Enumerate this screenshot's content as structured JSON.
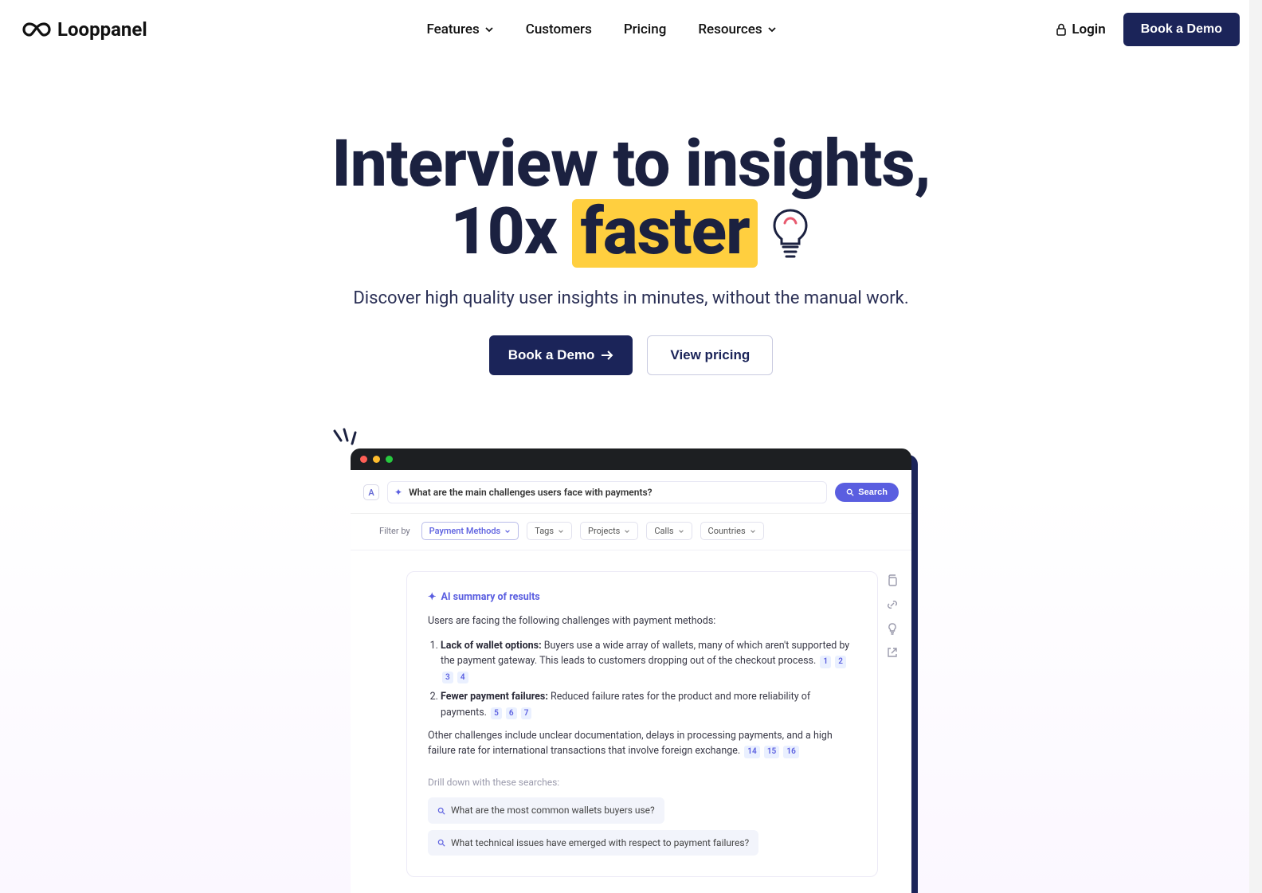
{
  "nav": {
    "brand": "Looppanel",
    "items": {
      "features": "Features",
      "customers": "Customers",
      "pricing": "Pricing",
      "resources": "Resources"
    },
    "login": "Login",
    "cta": "Book a Demo"
  },
  "hero": {
    "title_line1": "Interview to insights,",
    "title_prefix": "10x ",
    "title_highlight": "faster",
    "subtitle": "Discover high quality user insights in minutes, without the manual work.",
    "primary_cta": "Book a Demo",
    "secondary_cta": "View pricing"
  },
  "app": {
    "chip": "A",
    "query": "What are the main challenges users face with payments?",
    "search_label": "Search",
    "filter_by": "Filter by",
    "filters": {
      "payment_methods": "Payment Methods",
      "tags": "Tags",
      "projects": "Projects",
      "calls": "Calls",
      "countries": "Countries"
    },
    "summary": {
      "title": "AI summary of results",
      "intro": "Users are facing the following challenges with payment methods:",
      "item1_bold": "Lack of wallet options:",
      "item1_rest": " Buyers use a wide array of wallets, many of which aren't supported by the payment gateway. This leads to customers dropping out of the checkout process.",
      "item1_cites": [
        "1",
        "2",
        "3",
        "4"
      ],
      "item2_bold": "Fewer payment failures:",
      "item2_rest": " Reduced failure rates for the product and more reliability of payments.",
      "item2_cites": [
        "5",
        "6",
        "7"
      ],
      "other": "Other challenges include unclear documentation, delays in processing payments, and a high failure rate for international transactions that involve foreign exchange.",
      "other_cites": [
        "14",
        "15",
        "16"
      ],
      "drill_label": "Drill down with these searches:",
      "drill1": "What are the most common wallets buyers use?",
      "drill2": "What technical issues have emerged with respect to payment failures?"
    }
  }
}
